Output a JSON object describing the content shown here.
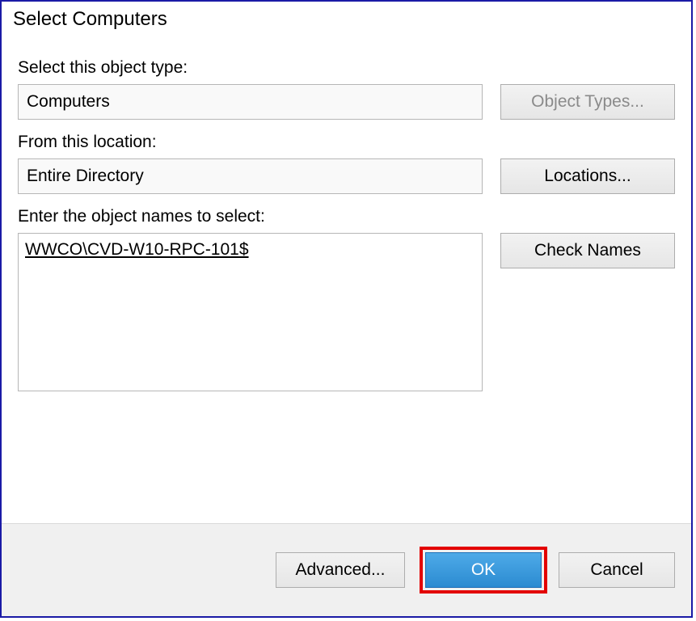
{
  "title": "Select Computers",
  "labels": {
    "object_type": "Select this object type:",
    "location": "From this location:",
    "names": "Enter the object names to select:"
  },
  "fields": {
    "object_type": "Computers",
    "location": "Entire Directory",
    "names_resolved": "WWCO\\CVD-W10-RPC-101$"
  },
  "buttons": {
    "object_types": "Object Types...",
    "locations": "Locations...",
    "check_names": "Check Names",
    "advanced": "Advanced...",
    "ok": "OK",
    "cancel": "Cancel"
  }
}
